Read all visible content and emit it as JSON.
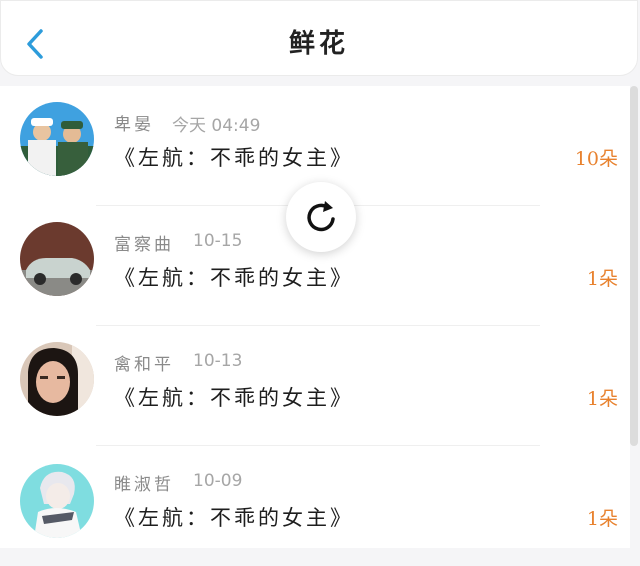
{
  "header": {
    "title": "鲜花",
    "back_icon": "chevron-left-icon",
    "accent": "#2d9cdb"
  },
  "refresh": {
    "icon": "refresh-icon"
  },
  "items": [
    {
      "name": "卑晏",
      "time": "今天 04:49",
      "book": "《左航：不乖的女主》",
      "count": "10朵"
    },
    {
      "name": "富察曲",
      "time": "10-15",
      "book": "《左航：不乖的女主》",
      "count": "1朵"
    },
    {
      "name": "禽和平",
      "time": "10-13",
      "book": "《左航：不乖的女主》",
      "count": "1朵"
    },
    {
      "name": "睢淑哲",
      "time": "10-09",
      "book": "《左航：不乖的女主》",
      "count": "1朵"
    }
  ],
  "colors": {
    "count": "#e8822f",
    "name": "#8a8a8a",
    "book": "#1e1e1e"
  }
}
